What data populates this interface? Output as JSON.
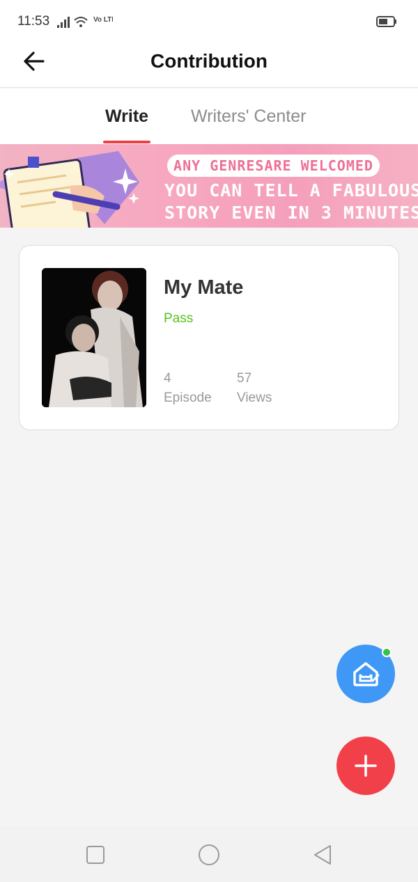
{
  "status_bar": {
    "time": "11:53",
    "network": "Vo LTE",
    "icons": [
      "signal-icon",
      "wifi-icon",
      "volte-icon",
      "battery-icon"
    ]
  },
  "header": {
    "title": "Contribution",
    "back_icon": "arrow-left-icon"
  },
  "tabs": [
    {
      "label": "Write",
      "active": true
    },
    {
      "label": "Writers' Center",
      "active": false
    }
  ],
  "banner": {
    "pill_text": "ANY GENRESARE WELCOMED",
    "line1": "YOU CAN TELL A FABULOUS",
    "line2": "STORY EVEN IN 3 MINUTES!"
  },
  "story": {
    "title": "My Mate",
    "status": "Pass",
    "episodes_value": "4",
    "episodes_label": "Episode",
    "views_value": "57",
    "views_label": "Views"
  },
  "fabs": {
    "home_icon": "writer-home-icon",
    "add_icon": "plus-icon"
  },
  "nav": {
    "icons": [
      "recent-apps-icon",
      "home-circle-icon",
      "back-triangle-icon"
    ]
  },
  "colors": {
    "accent": "#ef3f45",
    "pass": "#52c41a",
    "fab_blue": "#3f97f6",
    "fab_red": "#f2404a"
  }
}
